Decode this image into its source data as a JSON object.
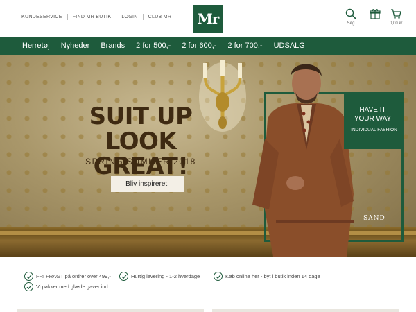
{
  "header": {
    "links": [
      "KUNDESERVICE",
      "FIND MR BUTIK",
      "LOGIN",
      "CLUB MR"
    ],
    "logo_text": "Mr",
    "search_label": "Søg",
    "cart_total": "0,00 kr"
  },
  "nav": {
    "items": [
      "Herretøj",
      "Nyheder",
      "Brands",
      "2 for 500,-",
      "2 for 600,-",
      "2 for 700,-",
      "UDSALG"
    ]
  },
  "hero": {
    "title_line1": "SUIT UP",
    "title_line2": "LOOK GREAT!",
    "subtitle": "SPRING/SUMMER 2018",
    "cta": "Bliv inspireret!",
    "promo_line1": "HAVE IT",
    "promo_line2": "YOUR WAY",
    "promo_line3": "- INDIVIDUAL FASHION",
    "brand": "SAND"
  },
  "usps": [
    "FRI FRAGT på ordrer over 499,-",
    "Hurtig levering - 1-2 hverdage",
    "Køb online her - byt i butik inden 14 dage",
    "Vi pakker med glæde gaver ind"
  ],
  "colors": {
    "brand_green": "#1e5b3c"
  }
}
